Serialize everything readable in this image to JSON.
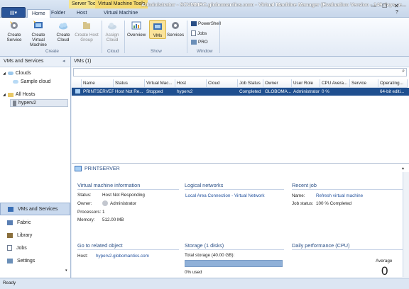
{
  "window": {
    "title": "Administrator - SCVMMRC.globomantics.com - Virtual Machine Manager (Evaluation Version - 149 days re...",
    "context_groups": [
      "Server Tools",
      "Virtual Machine Tools"
    ],
    "tabs": [
      "Home",
      "Folder",
      "Host",
      "Virtual Machine"
    ],
    "app_button_icon": "app-menu-icon"
  },
  "ribbon": {
    "create": {
      "label": "Create",
      "buttons": [
        "Create Service",
        "Create Virtual Machine",
        "Create Cloud",
        "Create Host Group"
      ]
    },
    "cloud": {
      "label": "Cloud",
      "buttons": [
        "Assign Cloud"
      ]
    },
    "show": {
      "label": "Show",
      "buttons": [
        "Overview",
        "VMs",
        "Services"
      ]
    },
    "window": {
      "label": "Window",
      "buttons": [
        "PowerShell",
        "Jobs",
        "PRO"
      ]
    }
  },
  "left": {
    "header": "VMs and Services",
    "tree": {
      "clouds": "Clouds",
      "sample_cloud": "Sample cloud",
      "all_hosts": "All Hosts",
      "host": "hyperv2"
    },
    "nav": [
      "VMs and Services",
      "Fabric",
      "Library",
      "Jobs",
      "Settings"
    ]
  },
  "main": {
    "header": "VMs (1)",
    "columns": [
      "Name",
      "Status",
      "Virtual Mac...",
      "Host",
      "Cloud",
      "Job Status",
      "Owner",
      "User Role",
      "CPU Avera...",
      "Service",
      "Operating..."
    ],
    "row": [
      "PRINTSERVER",
      "Host Not Re...",
      "Stopped",
      "hyperv2",
      "",
      "Completed",
      "GLOBOMA...",
      "Administrator",
      "0 %",
      "",
      "64-bit editi..."
    ]
  },
  "details": {
    "title": "PRINTSERVER",
    "vm_info": {
      "heading": "Virtual machine information",
      "status_label": "Status:",
      "status_value": "Host Not Responding",
      "owner_label": "Owner:",
      "owner_value": "Administrator",
      "proc_label": "Processors:",
      "proc_value": "1",
      "mem_label": "Memory:",
      "mem_value": "512.00 MB"
    },
    "logical": {
      "heading": "Logical networks",
      "value": "Local Area Connection - Virtual Network"
    },
    "recent_job": {
      "heading": "Recent job",
      "name_label": "Name:",
      "name_value": "Refresh virtual machine",
      "status_label": "Job status:",
      "status_value": "100 % Completed"
    },
    "related": {
      "heading": "Go to related object",
      "host_label": "Host:",
      "host_value": "hyperv2.globomantics.com"
    },
    "storage": {
      "heading": "Storage (1 disks)",
      "total": "Total storage (40.00 GB):",
      "used": "0% used"
    },
    "perf": {
      "heading": "Daily performance (CPU)",
      "avg_label": "Average",
      "avg_value": "0"
    }
  },
  "status_bar": {
    "text": "Ready"
  }
}
